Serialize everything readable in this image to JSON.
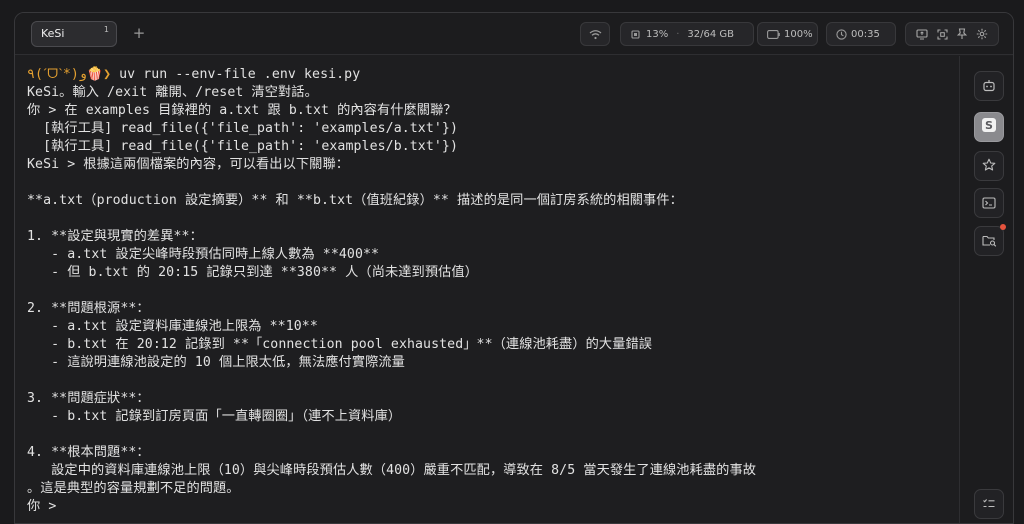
{
  "titlebar": {
    "tab": {
      "label": "KeSi",
      "index": "1"
    },
    "new_tab": "+",
    "memory": {
      "cpu": "13%",
      "ram": "32/64 GB"
    },
    "battery": "100%",
    "clock": "00:35"
  },
  "terminal": {
    "lines": [
      {
        "prefix": "٩(ˊᗜˋ*)و🍿❯",
        "text": " uv run --env-file .env kesi.py"
      },
      {
        "prefix": "",
        "text": "KeSi。輸入 /exit 離開、/reset 清空對話。"
      },
      {
        "prefix": "",
        "text": "你 > 在 examples 目錄裡的 a.txt 跟 b.txt 的內容有什麼關聯？"
      },
      {
        "prefix": "",
        "text": "  [執行工具] read_file({'file_path': 'examples/a.txt'})"
      },
      {
        "prefix": "",
        "text": "  [執行工具] read_file({'file_path': 'examples/b.txt'})"
      },
      {
        "prefix": "",
        "text": "KeSi > 根據這兩個檔案的內容，可以看出以下關聯："
      },
      {
        "prefix": "",
        "text": ""
      },
      {
        "prefix": "",
        "text": "**a.txt（production 設定摘要）** 和 **b.txt（值班紀錄）** 描述的是同一個訂房系統的相關事件："
      },
      {
        "prefix": "",
        "text": ""
      },
      {
        "prefix": "",
        "text": "1. **設定與現實的差異**："
      },
      {
        "prefix": "",
        "text": "   - a.txt 設定尖峰時段預估同時上線人數為 **400**"
      },
      {
        "prefix": "",
        "text": "   - 但 b.txt 的 20:15 記錄只到達 **380** 人（尚未達到預估值）"
      },
      {
        "prefix": "",
        "text": ""
      },
      {
        "prefix": "",
        "text": "2. **問題根源**："
      },
      {
        "prefix": "",
        "text": "   - a.txt 設定資料庫連線池上限為 **10**"
      },
      {
        "prefix": "",
        "text": "   - b.txt 在 20:12 記錄到 **「connection pool exhausted」**（連線池耗盡）的大量錯誤"
      },
      {
        "prefix": "",
        "text": "   - 這說明連線池設定的 10 個上限太低，無法應付實際流量"
      },
      {
        "prefix": "",
        "text": ""
      },
      {
        "prefix": "",
        "text": "3. **問題症狀**："
      },
      {
        "prefix": "",
        "text": "   - b.txt 記錄到訂房頁面「一直轉圈圈」（連不上資料庫）"
      },
      {
        "prefix": "",
        "text": ""
      },
      {
        "prefix": "",
        "text": "4. **根本問題**："
      },
      {
        "prefix": "",
        "text": "   設定中的資料庫連線池上限（10）與尖峰時段預估人數（400）嚴重不匹配，導致在 8/5 當天發生了連線池耗盡的事故"
      },
      {
        "prefix": "",
        "text": "。這是典型的容量規劃不足的問題。"
      },
      {
        "prefix": "",
        "text": "你 >"
      }
    ]
  },
  "icons": {
    "wifi": "wifi-icon",
    "memory": "memory-chip-icon",
    "battery": "battery-icon",
    "clock": "clock-icon",
    "sidebar": [
      "robot-icon",
      "s-logo-icon",
      "star-icon",
      "terminal-icon",
      "folder-search-icon",
      "list-icon"
    ]
  },
  "colors": {
    "background": "#1e1e20",
    "text": "#e2e2e2",
    "prompt": "#e4a030",
    "badge": "#e5533d"
  }
}
